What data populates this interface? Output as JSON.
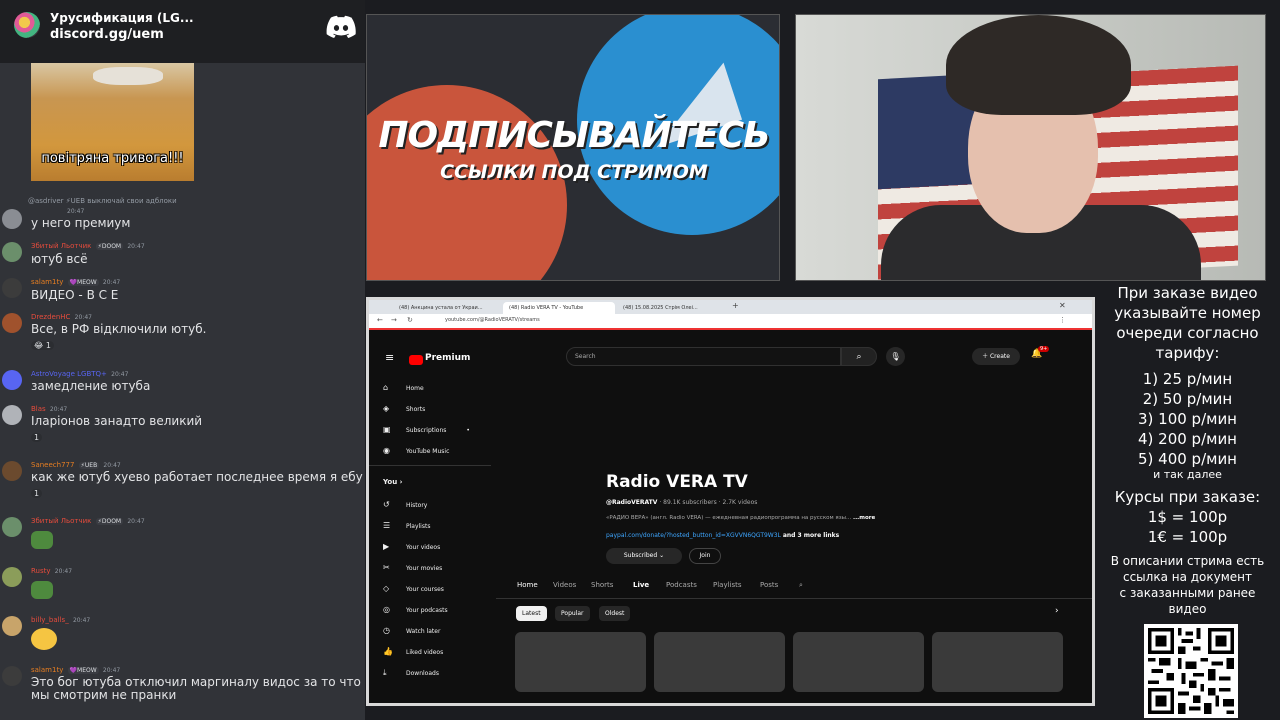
{
  "chat": {
    "server_name": "Урусификация (LG...",
    "server_link": "discord.gg/uem",
    "meme_caption": "повітряна тривога!!!",
    "reply_preview": "@asdriver  ⚡UEB выключай свои адблоки",
    "messages": [
      {
        "author": "",
        "badges": [],
        "time": "20:47",
        "text": "у него премиум",
        "reactions": []
      },
      {
        "author": "Збитый Льотчик",
        "badges": [
          "⚡DOOM"
        ],
        "time": "20:47",
        "text": "ютуб всё",
        "reactions": []
      },
      {
        "author": "salam1ty",
        "badges": [
          "💜MEOW"
        ],
        "time": "20:47",
        "text": "ВИДЕО - В С Е",
        "reactions": []
      },
      {
        "author": "DrezdenHC",
        "badges": [],
        "time": "20:47",
        "text": "Все,  в РФ відключили ютуб.",
        "reactions": [
          "😂 1"
        ]
      },
      {
        "author": "AstroVoyage LGBTQ+",
        "badges": [],
        "time": "20:47",
        "text": "замедление ютуба",
        "reactions": []
      },
      {
        "author": "Blas",
        "badges": [],
        "time": "20:47",
        "text": "Іларіонов занадто великий",
        "reactions": [
          "1"
        ]
      },
      {
        "author": "Saneech777",
        "badges": [
          "⚡UEB"
        ],
        "time": "20:47",
        "text": "как же ютуб хуево работает последнее время я ебу",
        "reactions": [
          "1"
        ]
      },
      {
        "author": "Збитый Льотчик",
        "badges": [
          "⚡DOOM"
        ],
        "time": "20:47",
        "text": "",
        "reactions": []
      },
      {
        "author": "Rusty",
        "badges": [],
        "time": "20:47",
        "text": "",
        "reactions": []
      },
      {
        "author": "billy_balls_",
        "badges": [],
        "time": "20:47",
        "text": "",
        "reactions": []
      },
      {
        "author": "salam1ty",
        "badges": [
          "💜MEOW"
        ],
        "time": "20:47",
        "text": "Это бог ютуба отключил маргиналу видос за то что",
        "text2": "мы смотрим не пранки",
        "reactions": []
      }
    ]
  },
  "banner": {
    "title": "ПОДПИСЫВАЙТЕСЬ",
    "subtitle": "ССЫЛКИ ПОД СТРИМОМ"
  },
  "browser": {
    "tabs": [
      "(48) Анкцина устала от Украи...",
      "(48) Radio VERA TV - YouTube",
      "(48) 15.08.2025 Стрім Олеі..."
    ],
    "url": "youtube.com/@RadioVERATV/streams",
    "premium_label": "Premium",
    "search_placeholder": "Search",
    "create_label": "Create",
    "notif_count": "9+",
    "sidebar_top": [
      "Home",
      "Shorts",
      "Subscriptions",
      "YouTube Music"
    ],
    "you_label": "You",
    "sidebar_you": [
      "History",
      "Playlists",
      "Your videos",
      "Your movies",
      "Your courses",
      "Your podcasts",
      "Watch later",
      "Liked videos",
      "Downloads"
    ],
    "channel": {
      "name": "Radio VERA TV",
      "handle": "@RadioVERATV",
      "subscribers": "89.1K subscribers",
      "videos": "2.7K videos",
      "description": "«РАДИО ВЕРА» (англ. Radio VERA) — ежедневная радиопрограмма на русском язы...",
      "more": "...more",
      "link": "paypal.com/donate/?hosted_button_id=XGVVN6QGT9W3L",
      "more_links": "and 3 more links",
      "subscribed_label": "Subscribed",
      "join_label": "Join"
    },
    "channel_tabs": [
      "Home",
      "Videos",
      "Shorts",
      "Live",
      "Podcasts",
      "Playlists",
      "Posts"
    ],
    "active_tab": "Live",
    "filter_chips": [
      "Latest",
      "Popular",
      "Oldest"
    ]
  },
  "info": {
    "header_lines": [
      "При заказе видео",
      "указывайте номер",
      "очереди согласно",
      "тарифу:"
    ],
    "tariffs": [
      "1) 25 р/мин",
      "2) 50 р/мин",
      "3) 100 р/мин",
      "4) 200 р/мин",
      "5) 400 р/мин"
    ],
    "tariff_more": "и так далее",
    "rates_title": "Курсы при заказе:",
    "rates": [
      "1$ = 100р",
      "1€ = 100р"
    ],
    "note_lines": [
      "В описании стрима есть",
      "ссылка на документ",
      "с заказанными ранее",
      "видео"
    ]
  }
}
